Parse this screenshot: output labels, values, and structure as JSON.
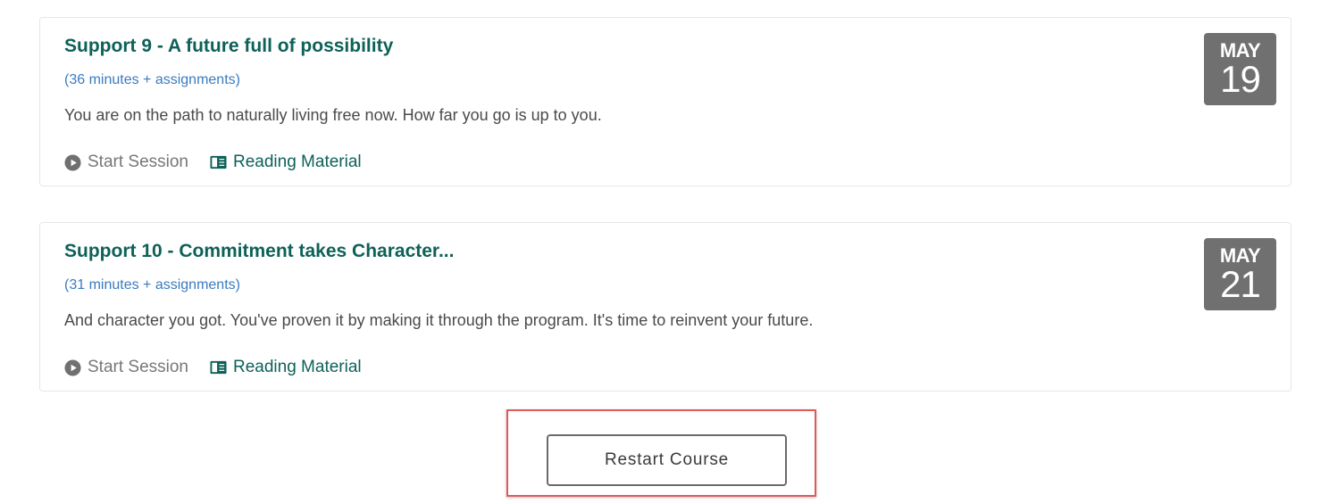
{
  "sessions": [
    {
      "title": "Support 9 - A future full of possibility",
      "duration": "(36 minutes + assignments)",
      "description": "You are on the path to naturally living free now. How far you go is up to you.",
      "start_label": "Start Session",
      "reading_label": "Reading Material",
      "date_month": "MAY",
      "date_day": "19"
    },
    {
      "title": "Support 10 - Commitment takes Character...",
      "duration": "(31 minutes + assignments)",
      "description": "And character you got. You've proven it by making it through the program. It's time to reinvent your future.",
      "start_label": "Start Session",
      "reading_label": "Reading Material",
      "date_month": "MAY",
      "date_day": "21"
    }
  ],
  "restart_button": {
    "label": "Restart Course"
  },
  "icons": {
    "start": "play-circle-icon",
    "reading": "book-icon"
  },
  "colors": {
    "title": "#0d6158",
    "duration": "#3a7bbf",
    "badge": "#707070",
    "highlight": "#e05a5a"
  }
}
